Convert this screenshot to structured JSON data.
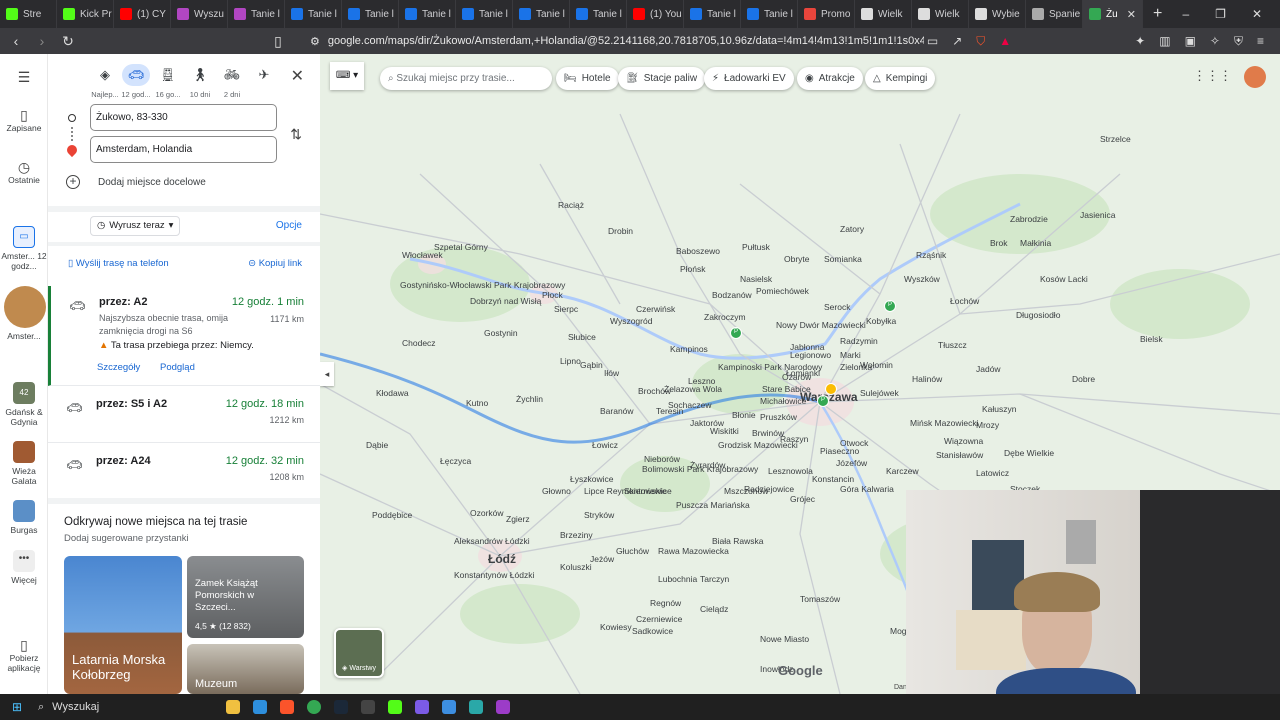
{
  "browser": {
    "tabs": [
      {
        "title": "Stre",
        "color": "#53fc18"
      },
      {
        "title": "Kick Pr",
        "color": "#53fc18"
      },
      {
        "title": "(1) CY",
        "color": "#ff0000"
      },
      {
        "title": "Wyszu",
        "color": "#b146c2"
      },
      {
        "title": "Tanie l",
        "color": "#b146c2"
      },
      {
        "title": "Tanie l",
        "color": "#1a73e8"
      },
      {
        "title": "Tanie l",
        "color": "#1a73e8"
      },
      {
        "title": "Tanie l",
        "color": "#1a73e8"
      },
      {
        "title": "Tanie l",
        "color": "#1a73e8"
      },
      {
        "title": "Tanie l",
        "color": "#1a73e8"
      },
      {
        "title": "Tanie l",
        "color": "#1a73e8"
      },
      {
        "title": "(1) You",
        "color": "#ff0000"
      },
      {
        "title": "Tanie l",
        "color": "#1a73e8"
      },
      {
        "title": "Tanie l",
        "color": "#1a73e8"
      },
      {
        "title": "Promo",
        "color": "#e8453c"
      },
      {
        "title": "Wielk",
        "color": "#dddddd"
      },
      {
        "title": "Wielk",
        "color": "#dddddd"
      },
      {
        "title": "Wybie",
        "color": "#dddddd"
      },
      {
        "title": "Spanie",
        "color": "#aaaaaa"
      }
    ],
    "active_tab": {
      "title": "Żu",
      "close": "✕",
      "color": "#34a853"
    },
    "new_tab": "+",
    "url": "google.com/maps/dir/Żukowo/Amsterdam,+Holandia/@52.2141168,20.7818705,10.96z/data=!4m14!4m13!1m5!1m1!1s0x46fd9c1902a94e8b:0..."
  },
  "rail": {
    "saved": "Zapisane",
    "recent": "Ostatnie",
    "amsterdam_1": "Amster... 12 godz...",
    "amsterdam_2": "Amster...",
    "gdansk": "Gdańsk & Gdynia",
    "galata": "Wieża Galata",
    "burgas": "Burgas",
    "more": "Więcej",
    "app": "Pobierz aplikację",
    "badge": "42"
  },
  "modes": [
    {
      "label": "Najlep..."
    },
    {
      "label": "12 god..."
    },
    {
      "label": "16 go..."
    },
    {
      "label": "10 dni"
    },
    {
      "label": "2 dni"
    }
  ],
  "directions": {
    "origin": "Żukowo, 83-330",
    "destination": "Amsterdam, Holandia",
    "add_stop": "Dodaj miejsce docelowe",
    "depart": "Wyrusz teraz",
    "options": "Opcje",
    "send_phone": "Wyślij trasę na telefon",
    "copy_link": "Kopiuj link"
  },
  "routes": [
    {
      "name": "przez: A2",
      "time": "12 godz. 1 min",
      "km": "1171 km",
      "desc": "Najszybsza obecnie trasa, omija zamknięcia drogi na S6",
      "warn": "Ta trasa przebiega przez: Niemcy.",
      "details": "Szczegóły",
      "preview": "Podgląd"
    },
    {
      "name": "przez: S5 i A2",
      "time": "12 godz. 18 min",
      "km": "1212 km"
    },
    {
      "name": "przez: A24",
      "time": "12 godz. 32 min",
      "km": "1208 km"
    }
  ],
  "discover": {
    "title": "Odkrywaj nowe miejsca na tej trasie",
    "subtitle": "Dodaj sugerowane przystanki",
    "card1": "Latarnia Morska Kołobrzeg",
    "card2": "Zamek Książąt Pomorskich w Szczeci...",
    "card2_rating": "4,5 ★ (12 832)",
    "card3": "Muzeum"
  },
  "map": {
    "search_placeholder": "Szukaj miejsc przy trasie...",
    "chips": [
      "Hotele",
      "Stacje paliw",
      "Ładowarki EV",
      "Atrakcje",
      "Kempingi"
    ],
    "layers": "Warstwy",
    "logo": "Google",
    "credit": "Dan",
    "towns": [
      {
        "n": "Włocławek"
      },
      {
        "n": "Płock"
      },
      {
        "n": "Łódź"
      },
      {
        "n": "Sierpc"
      },
      {
        "n": "Płońsk"
      },
      {
        "n": "Nasielsk"
      },
      {
        "n": "Serock"
      },
      {
        "n": "Wyszków"
      },
      {
        "n": "Łochów"
      },
      {
        "n": "Radzymin"
      },
      {
        "n": "Wołomin"
      },
      {
        "n": "Sulejówek"
      },
      {
        "n": "Mińsk Mazowiecki"
      },
      {
        "n": "Otwock"
      },
      {
        "n": "Piaseczno"
      },
      {
        "n": "Grodzisk Mazowiecki"
      },
      {
        "n": "Żyrardów"
      },
      {
        "n": "Sochaczew"
      },
      {
        "n": "Łowicz"
      },
      {
        "n": "Kutno"
      },
      {
        "n": "Łęczyca"
      },
      {
        "n": "Zgierz"
      },
      {
        "n": "Skierniewice"
      },
      {
        "n": "Rawa Mazowiecka"
      },
      {
        "n": "Brzeziny"
      },
      {
        "n": "Koluszki"
      },
      {
        "n": "Biała Rawska"
      },
      {
        "n": "Tomaszów"
      },
      {
        "n": "Grójec"
      },
      {
        "n": "Góra Kalwaria"
      },
      {
        "n": "Nowy Dwór Mazowiecki"
      },
      {
        "n": "Legionowo"
      },
      {
        "n": "Łomianki"
      },
      {
        "n": "Jabłonna"
      },
      {
        "n": "Kampinoski Park Narodowy"
      },
      {
        "n": "Gostynin"
      },
      {
        "n": "Żychlin"
      },
      {
        "n": "Bolimowski Park Krajobrazowy"
      },
      {
        "n": "Stryków"
      },
      {
        "n": "Głowno"
      },
      {
        "n": "Kłodawa"
      },
      {
        "n": "Chodecz"
      },
      {
        "n": "Brok"
      },
      {
        "n": "Małkinia"
      },
      {
        "n": "Kosów Lacki"
      },
      {
        "n": "Mrozy"
      },
      {
        "n": "Kałuszyn"
      },
      {
        "n": "Latowicz"
      },
      {
        "n": "Stoczek"
      },
      {
        "n": "Baboszewo"
      },
      {
        "n": "Drobin"
      },
      {
        "n": "Raciąż"
      },
      {
        "n": "Strzelce"
      },
      {
        "n": "Bielsk"
      },
      {
        "n": "Gąbin"
      },
      {
        "n": "Słubice"
      },
      {
        "n": "Iłów"
      },
      {
        "n": "Brochów"
      },
      {
        "n": "Żelazowa Wola"
      },
      {
        "n": "Błonie"
      },
      {
        "n": "Pruszków"
      },
      {
        "n": "Brwinów"
      },
      {
        "n": "Tarczyn"
      },
      {
        "n": "Mszczonów"
      },
      {
        "n": "Wiskitki"
      },
      {
        "n": "Nieborów"
      },
      {
        "n": "Lipce Reymontowskie"
      },
      {
        "n": "Ozorków"
      },
      {
        "n": "Aleksandrów Łódzki"
      },
      {
        "n": "Konstantynów Łódzki"
      },
      {
        "n": "Poddębice"
      },
      {
        "n": "Dąbie"
      },
      {
        "n": "Łyszkowice"
      },
      {
        "n": "Jeżów"
      },
      {
        "n": "Głuchów"
      },
      {
        "n": "Lubochnia"
      },
      {
        "n": "Mogielnica"
      },
      {
        "n": "Nowe Miasto"
      },
      {
        "n": "Warka"
      },
      {
        "n": "Dobrzyń nad Wisłą"
      },
      {
        "n": "Szpetal Górny"
      },
      {
        "n": "Gostynińsko-Włocławski Park Krajobrazowy"
      },
      {
        "n": "Lipno"
      },
      {
        "n": "Bodzanów"
      },
      {
        "n": "Zakroczym"
      },
      {
        "n": "Czerwińsk"
      },
      {
        "n": "Wyszogród"
      },
      {
        "n": "Pomiechówek"
      },
      {
        "n": "Dobre"
      },
      {
        "n": "Wiązowna"
      },
      {
        "n": "Halinów"
      },
      {
        "n": "Zielonka"
      },
      {
        "n": "Marki"
      },
      {
        "n": "Kobyłka"
      },
      {
        "n": "Tłuszcz"
      },
      {
        "n": "Jadów"
      },
      {
        "n": "Pułtusk"
      },
      {
        "n": "Obryte"
      },
      {
        "n": "Zatory"
      },
      {
        "n": "Długosiodło"
      },
      {
        "n": "Rząśnik"
      },
      {
        "n": "Somianka"
      },
      {
        "n": "Zabrodzie"
      },
      {
        "n": "Jasienica"
      },
      {
        "n": "Stanisławów"
      },
      {
        "n": "Dębe Wielkie"
      },
      {
        "n": "Józefów"
      },
      {
        "n": "Karczew"
      },
      {
        "n": "Celestynów"
      },
      {
        "n": "Kołbiel"
      },
      {
        "n": "Konstancin"
      },
      {
        "n": "Lesznowola"
      },
      {
        "n": "Raszyn"
      },
      {
        "n": "Michałowice"
      },
      {
        "n": "Ożarów"
      },
      {
        "n": "Stare Babice"
      },
      {
        "n": "Leszno"
      },
      {
        "n": "Kampinos"
      },
      {
        "n": "Teresin"
      },
      {
        "n": "Baranów"
      },
      {
        "n": "Jaktorów"
      },
      {
        "n": "Radziejowice"
      },
      {
        "n": "Puszcza Mariańska"
      },
      {
        "n": "Kowiesy"
      },
      {
        "n": "Sadkowice"
      },
      {
        "n": "Regnów"
      },
      {
        "n": "Cielądz"
      },
      {
        "n": "Czerniewice"
      },
      {
        "n": "Inowłódz"
      },
      {
        "n": "Rzeczyca"
      },
      {
        "n": "Warszawa"
      }
    ]
  },
  "taskbar": {
    "search": "Wyszukaj"
  },
  "colors": {
    "accent": "#1a73e8",
    "green": "#188038",
    "route": "#1a73e8"
  }
}
